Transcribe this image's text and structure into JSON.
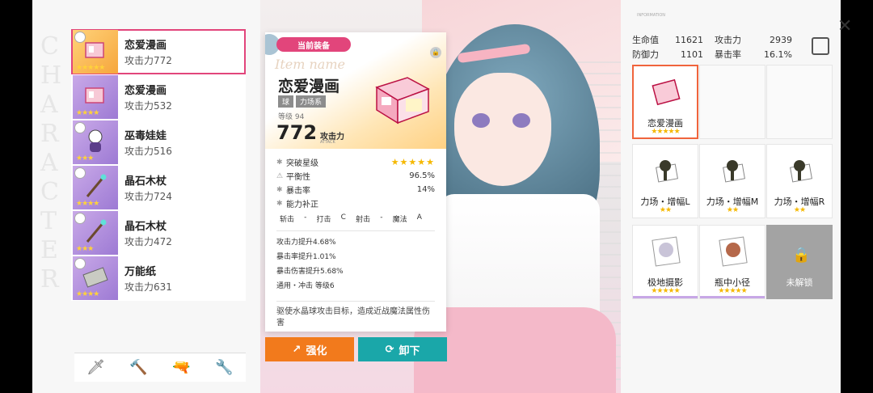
{
  "left_list": {
    "bg_word": "CHARACTER",
    "items": [
      {
        "name": "恋爱漫画",
        "atk": "攻击力772",
        "stars": "★★★★★",
        "selected": true
      },
      {
        "name": "恋爱漫画",
        "atk": "攻击力532",
        "stars": "★★★★",
        "selected": false
      },
      {
        "name": "巫毒娃娃",
        "atk": "攻击力516",
        "stars": "★★★",
        "selected": false
      },
      {
        "name": "晶石木杖",
        "atk": "攻击力724",
        "stars": "★★★★",
        "selected": false
      },
      {
        "name": "晶石木杖",
        "atk": "攻击力472",
        "stars": "★★★",
        "selected": false
      },
      {
        "name": "万能纸",
        "atk": "攻击力631",
        "stars": "★★★★",
        "selected": false
      }
    ],
    "tabs": [
      {
        "icon": "sword-icon",
        "glyph": "🗡"
      },
      {
        "icon": "hammer-icon",
        "glyph": "🔨"
      },
      {
        "icon": "gun-icon",
        "glyph": "🔫"
      },
      {
        "icon": "wrench-icon",
        "glyph": "🔧"
      }
    ]
  },
  "card": {
    "badge": "当前装备",
    "script_title": "Item name",
    "name": "恋爱漫画",
    "tags": [
      "球",
      "力场系"
    ],
    "level": "等级 94",
    "attack_value": "772",
    "attack_label": "攻击力",
    "attack_sub": "ATTACK",
    "stats": [
      {
        "icon": "✱",
        "label": "突破星级",
        "value": "★★★★★"
      },
      {
        "icon": "⚠",
        "label": "平衡性",
        "value": "96.5%"
      },
      {
        "icon": "✱",
        "label": "暴击率",
        "value": "14%"
      },
      {
        "icon": "✱",
        "label": "能力补正",
        "value": ""
      }
    ],
    "correction": [
      "斩击",
      "-",
      "打击",
      "C",
      "射击",
      "-",
      "魔法",
      "A"
    ],
    "bonuses": [
      "攻击力提升4.68%",
      "暴击率提升1.01%",
      "暴击伤害提升5.68%",
      "通用・冲击 等级6"
    ],
    "description": "驱使水晶球攻击目标，造成近战魔法属性伤害"
  },
  "buttons": {
    "upgrade": "强化",
    "unequip": "卸下"
  },
  "right": {
    "stats_header": "INFORMATION",
    "stats": [
      {
        "k": "生命值",
        "v": "11621",
        "k2": "攻击力",
        "v2": "2939"
      },
      {
        "k": "防御力",
        "v": "1101",
        "k2": "暴击率",
        "v2": "16.1%"
      }
    ],
    "grid": [
      {
        "label": "恋爱漫画",
        "stars": "★★★★★",
        "state": "selected"
      },
      {
        "label": "",
        "stars": "",
        "state": "empty"
      },
      {
        "label": "",
        "stars": "",
        "state": "empty"
      },
      {
        "label": "力场・增幅L",
        "stars": "★★",
        "state": "normal"
      },
      {
        "label": "力场・增幅M",
        "stars": "★★",
        "state": "normal"
      },
      {
        "label": "力场・增幅R",
        "stars": "★★",
        "state": "normal"
      },
      {
        "label": "极地摄影",
        "stars": "★★★★★",
        "state": "normal"
      },
      {
        "label": "瓶中小径",
        "stars": "★★★★★",
        "state": "normal"
      },
      {
        "label": "未解锁",
        "stars": "",
        "state": "locked"
      }
    ]
  },
  "colors": {
    "accent": "#e2457b",
    "upgrade": "#f27a1c",
    "unequip": "#1aa7a9"
  }
}
